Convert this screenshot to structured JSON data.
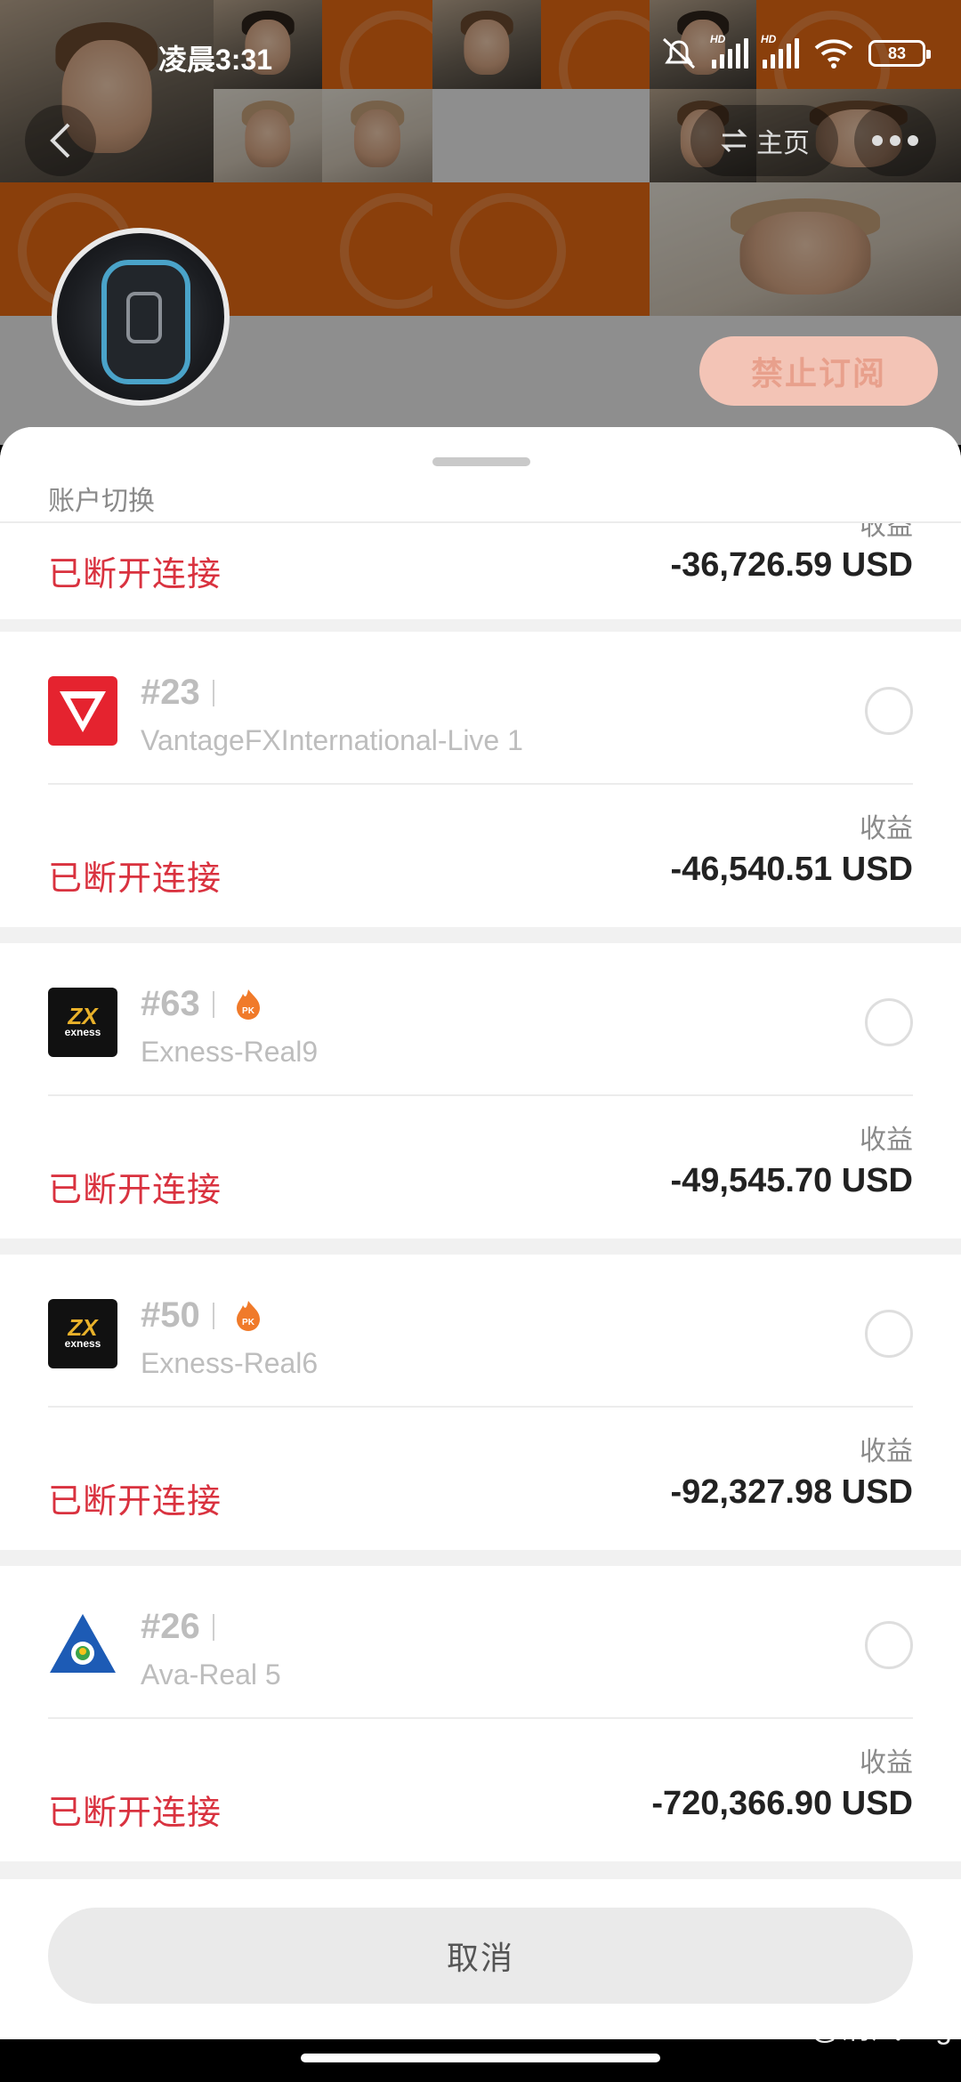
{
  "status_bar": {
    "time": "凌晨3:31",
    "hd_label": "HD",
    "battery": "83"
  },
  "profile_header": {
    "home_label": "主页",
    "subscribe_button": "禁止订阅"
  },
  "sheet": {
    "title": "账户切换",
    "profit_label": "收益",
    "cancel_label": "取消",
    "accounts": [
      {
        "status": "已断开连接",
        "amount": "-36,726.59 USD"
      },
      {
        "number": "#23",
        "server": "VantageFXInternational-Live 1",
        "logo": "vantage-logo",
        "status": "已断开连接",
        "amount": "-46,540.51 USD"
      },
      {
        "number": "#63",
        "server": "Exness-Real9",
        "logo": "exness-logo",
        "badge": "pk-fire-icon",
        "status": "已断开连接",
        "amount": "-49,545.70 USD"
      },
      {
        "number": "#50",
        "server": "Exness-Real6",
        "logo": "exness-logo",
        "badge": "pk-fire-icon",
        "status": "已断开连接",
        "amount": "-92,327.98 USD"
      },
      {
        "number": "#26",
        "server": "Ava-Real 5",
        "logo": "ava-logo",
        "status": "已断开连接",
        "amount": "-720,366.90 USD"
      }
    ]
  },
  "logo_text": {
    "exness_mark": "ZX",
    "exness_word": "exness",
    "pk": "PK"
  },
  "watermark": "@清风ong",
  "colors": {
    "disconnected": "#d9323f",
    "orange_tile": "#e76a13",
    "vantage_red": "#e5232f",
    "exness_gold": "#e9b12a"
  }
}
